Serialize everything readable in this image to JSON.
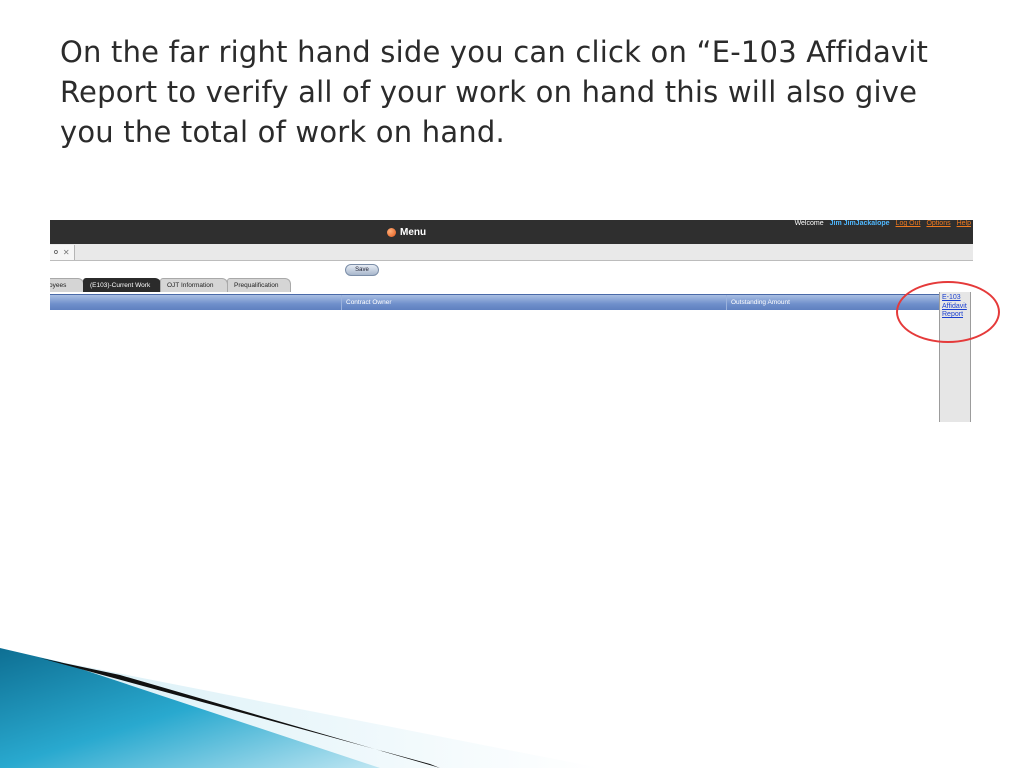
{
  "slide": {
    "title": "On the far right hand side you can click on “E-103 Affidavit Report to verify all of your work on hand  this will also give you the total of work on hand."
  },
  "app": {
    "menu_label": "Menu",
    "welcome_text": "Welcome",
    "user_name": "Jim JimJackalope",
    "logout_label": "Log Out",
    "options_label": "Options",
    "help_label": "Help",
    "doc_tab_label": "o",
    "save_label": "Save",
    "tabs": [
      {
        "label": "oyees"
      },
      {
        "label": "(E103)-Current Work"
      },
      {
        "label": "OJT Information"
      },
      {
        "label": "Prequalification"
      }
    ],
    "active_tab": "(E103)-Current Work",
    "columns": [
      {
        "label": ""
      },
      {
        "label": "Contract Owner"
      },
      {
        "label": "Outstanding Amount"
      }
    ],
    "side_link_label": "E-103 Affidavit Report"
  },
  "colors": {
    "topbar": "#2f2f2f",
    "grid_header": "#6f8fcb",
    "highlight_circle": "#e53a3a",
    "link": "#1a3fd0",
    "deco_teal": "#1a8fb0"
  }
}
